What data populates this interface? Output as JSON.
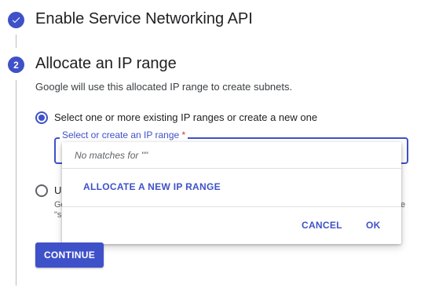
{
  "step1": {
    "title": "Enable Service Networking API",
    "status_icon": "check-icon"
  },
  "step2": {
    "number": "2",
    "title": "Allocate an IP range",
    "description": "Google will use this allocated IP range to create subnets.",
    "option_existing": {
      "label": "Select one or more existing IP ranges or create a new one",
      "selected": true
    },
    "option_use": {
      "label": "Us",
      "sub_line1": "Go",
      "sub_line2": "\"s",
      "sub_right": "e",
      "selected": false
    },
    "ip_field": {
      "label": "Select or create an IP range",
      "required_mark": "*"
    },
    "dropdown": {
      "no_matches": "No matches for \"\"",
      "allocate_label": "ALLOCATE A NEW IP RANGE",
      "cancel_label": "CANCEL",
      "ok_label": "OK"
    },
    "continue_label": "CONTINUE"
  },
  "colors": {
    "accent": "#3f51c9",
    "required": "#d93025",
    "divider": "#e0e0e0"
  }
}
